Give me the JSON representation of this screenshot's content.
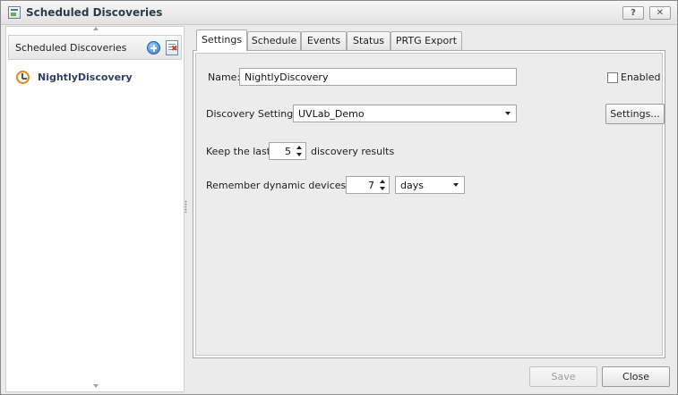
{
  "window": {
    "title": "Scheduled Discoveries",
    "help_label": "?",
    "close_label": "✕"
  },
  "sidebar": {
    "header": "Scheduled Discoveries",
    "items": [
      {
        "label": "NightlyDiscovery"
      }
    ]
  },
  "tabs": [
    {
      "label": "Settings",
      "active": true
    },
    {
      "label": "Schedule",
      "active": false
    },
    {
      "label": "Events",
      "active": false
    },
    {
      "label": "Status",
      "active": false
    },
    {
      "label": "PRTG Export",
      "active": false
    }
  ],
  "settings": {
    "name_label": "Name:",
    "name_value": "NightlyDiscovery",
    "enabled_label": "Enabled",
    "enabled_checked": false,
    "discovery_settings_label": "Discovery Settings:",
    "discovery_settings_value": "UVLab_Demo",
    "settings_button": "Settings...",
    "keep_last_label": "Keep the last",
    "keep_last_value": "5",
    "discovery_results_label": "discovery results",
    "remember_label": "Remember dynamic devices for",
    "remember_value": "7",
    "remember_unit": "days"
  },
  "footer": {
    "save_label": "Save",
    "save_enabled": false,
    "close_label": "Close"
  }
}
